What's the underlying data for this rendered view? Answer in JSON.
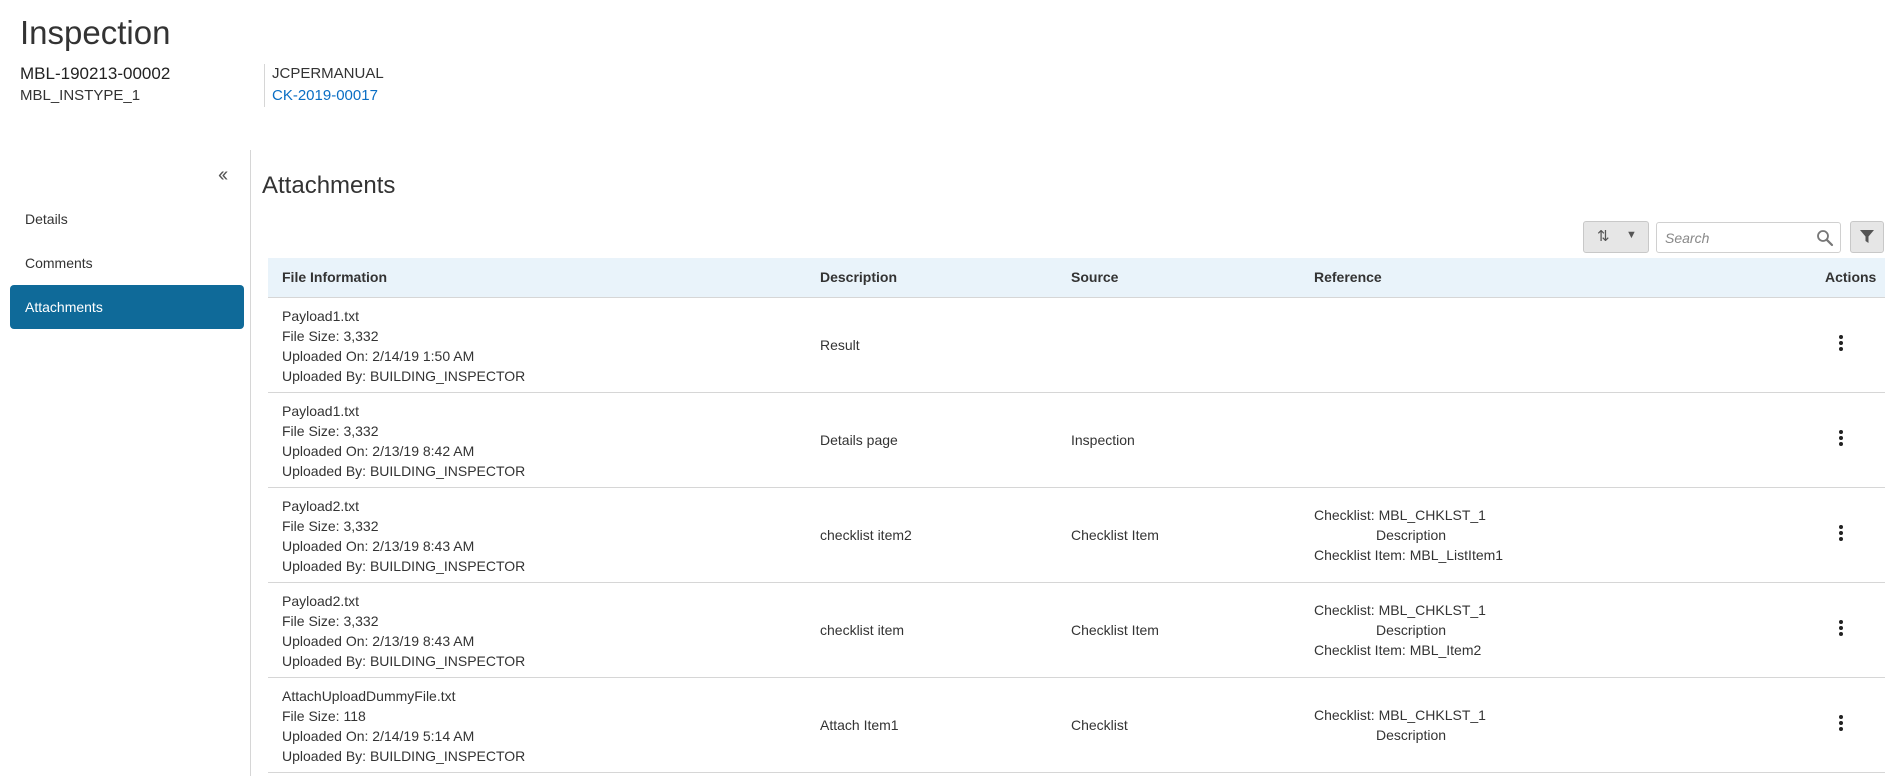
{
  "header": {
    "title": "Inspection",
    "record_id": "MBL-190213-00002",
    "record_type": "MBL_INSTYPE_1",
    "owner": "JCPERMANUAL",
    "case_link": "CK-2019-00017"
  },
  "sidebar": {
    "collapse_icon": "double-chevron-left-icon",
    "items": [
      {
        "label": "Details",
        "active": false
      },
      {
        "label": "Comments",
        "active": false
      },
      {
        "label": "Attachments",
        "active": true
      }
    ]
  },
  "main": {
    "title": "Attachments",
    "search": {
      "placeholder": "Search",
      "value": ""
    },
    "columns": {
      "file_info": "File Information",
      "description": "Description",
      "source": "Source",
      "reference": "Reference",
      "actions": "Actions"
    },
    "rows": [
      {
        "name": "Payload1.txt",
        "size": "File Size: 3,332",
        "uploaded_on": "Uploaded On: 2/14/19 1:50 AM",
        "uploaded_by": "Uploaded By: BUILDING_INSPECTOR",
        "description": "Result",
        "source": "",
        "ref1": "",
        "ref2": "",
        "ref3": ""
      },
      {
        "name": "Payload1.txt",
        "size": "File Size: 3,332",
        "uploaded_on": "Uploaded On: 2/13/19 8:42 AM",
        "uploaded_by": "Uploaded By: BUILDING_INSPECTOR",
        "description": "Details page",
        "source": "Inspection",
        "ref1": "",
        "ref2": "",
        "ref3": ""
      },
      {
        "name": "Payload2.txt",
        "size": "File Size: 3,332",
        "uploaded_on": "Uploaded On: 2/13/19 8:43 AM",
        "uploaded_by": "Uploaded By: BUILDING_INSPECTOR",
        "description": "checklist item2",
        "source": "Checklist Item",
        "ref1": "Checklist: MBL_CHKLST_1",
        "ref2": "Description",
        "ref3": "Checklist Item: MBL_ListItem1"
      },
      {
        "name": "Payload2.txt",
        "size": "File Size: 3,332",
        "uploaded_on": "Uploaded On: 2/13/19 8:43 AM",
        "uploaded_by": "Uploaded By: BUILDING_INSPECTOR",
        "description": "checklist item",
        "source": "Checklist Item",
        "ref1": "Checklist: MBL_CHKLST_1",
        "ref2": "Description",
        "ref3": "Checklist Item: MBL_Item2"
      },
      {
        "name": "AttachUploadDummyFile.txt",
        "size": "File Size: 118",
        "uploaded_on": "Uploaded On: 2/14/19 5:14 AM",
        "uploaded_by": "Uploaded By: BUILDING_INSPECTOR",
        "description": "Attach Item1",
        "source": "Checklist",
        "ref1": "Checklist: MBL_CHKLST_1",
        "ref2": "Description",
        "ref3": ""
      }
    ]
  },
  "colors": {
    "accent": "#0f6a99",
    "link": "#0a6ec4",
    "table_header_bg": "#e9f3fa"
  },
  "icons": {
    "sort": "sort-icon",
    "sort_caret": "caret-down-icon",
    "search": "search-icon",
    "filter": "filter-icon",
    "row_actions": "kebab-menu-icon"
  }
}
